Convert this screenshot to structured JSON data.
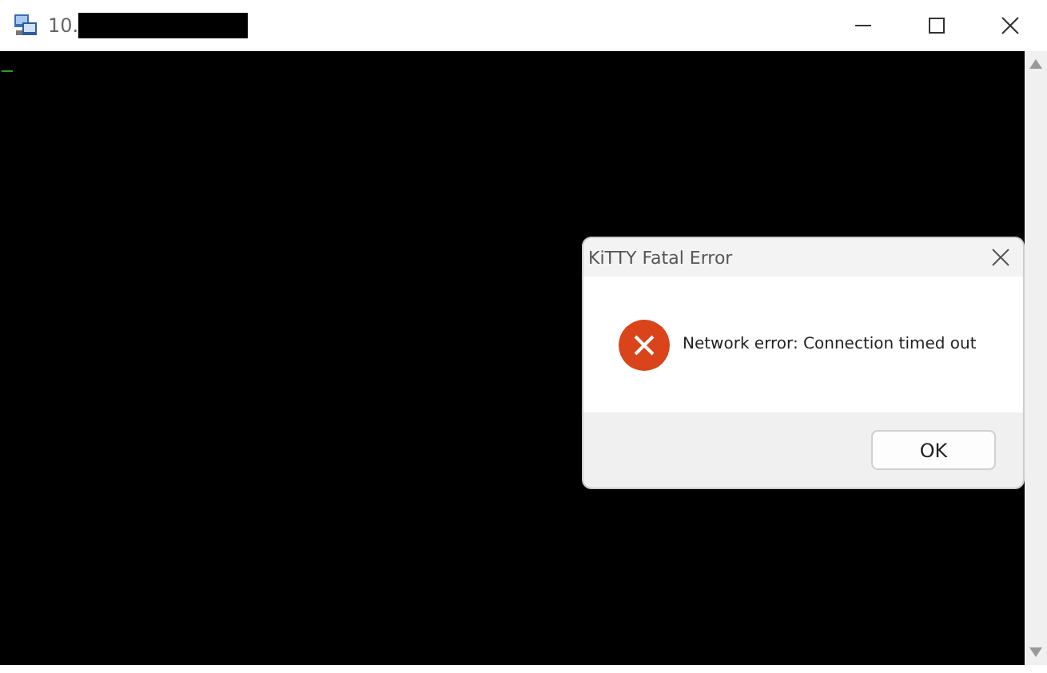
{
  "window": {
    "title": "10."
  },
  "dialog": {
    "title": "KiTTY Fatal Error",
    "message": "Network error: Connection timed out",
    "buttons": [
      "OK"
    ]
  }
}
